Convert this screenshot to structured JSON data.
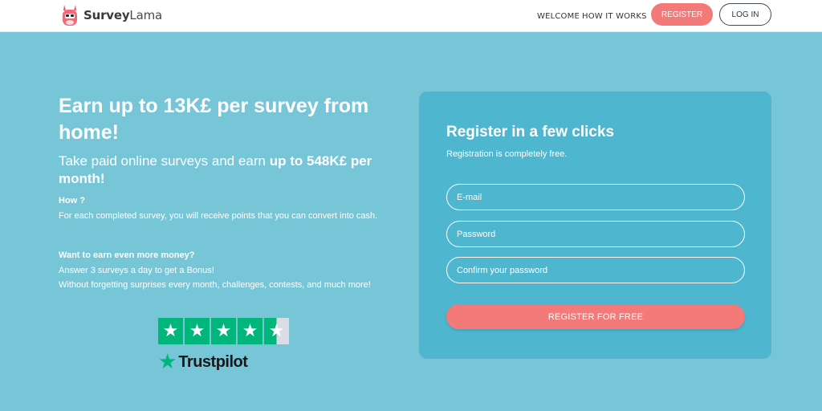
{
  "header": {
    "logo_prefix": "Survey",
    "logo_suffix": "Lama",
    "nav": {
      "welcome": "WELCOME",
      "how": "HOW IT WORKS"
    },
    "register_label": "REGISTER",
    "login_label": "LOG IN"
  },
  "hero": {
    "title": "Earn up to 13K£ per survey from home!",
    "subtitle_plain": "Take paid online surveys and earn ",
    "subtitle_bold": "up to 548K£ per month!",
    "how_heading": "How ?",
    "how_text": "For each completed survey, you will receive points that you can convert into cash.",
    "more_heading": "Want to earn even more money?",
    "more_line1": "Answer 3 surveys a day to get a Bonus!",
    "more_line2": "Without forgetting surprises every month, challenges, contests, and much more!"
  },
  "trustpilot": {
    "rating": 4.5,
    "max": 5,
    "label": "Trustpilot"
  },
  "register": {
    "title": "Register in a few clicks",
    "subtitle": "Registration is completely free.",
    "email_placeholder": "E-mail",
    "password_placeholder": "Password",
    "confirm_placeholder": "Confirm your password",
    "submit_label": "REGISTER FOR FREE"
  },
  "colors": {
    "background": "#76c6d8",
    "card": "#4fb6cf",
    "accent": "#f47a7a",
    "trustpilot_green": "#00b67a"
  }
}
